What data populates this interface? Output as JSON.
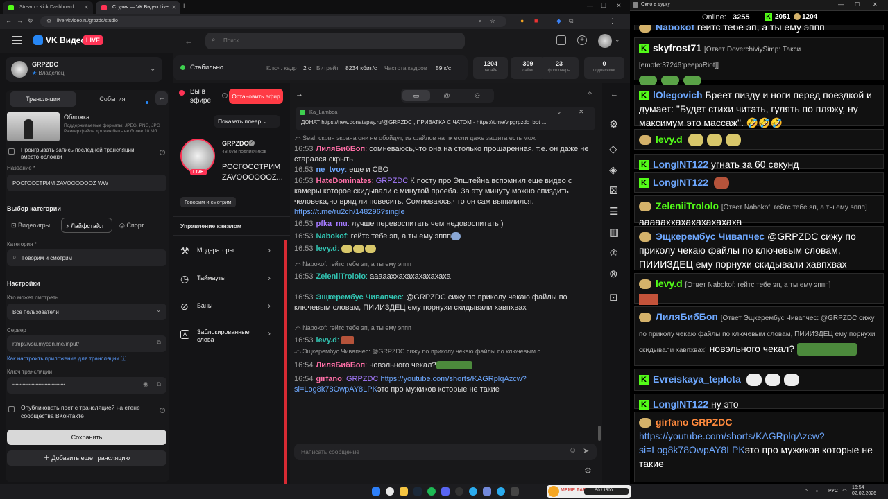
{
  "browser": {
    "tabs": [
      {
        "label": "Stream - Kick Dashboard",
        "color": "#53fc18"
      },
      {
        "label": "Студия — VK Видео Live",
        "color": "#ff3355"
      }
    ],
    "url": "live.vkvideo.ru/grpzdc/studio"
  },
  "vk": {
    "logo": "VK Видео",
    "live_badge": "LIVE",
    "search_placeholder": "Поиск"
  },
  "profile": {
    "name": "GRPZDC",
    "role": "Владелец"
  },
  "status": {
    "state": "Стабильно",
    "keyframe_label": "Ключ. кадр",
    "keyframe": "2 с",
    "bitrate_label": "Битрейт",
    "bitrate": "8234 кбит/с",
    "fps_label": "Частота кадров",
    "fps": "59 к/с"
  },
  "stats": [
    {
      "value": "1204",
      "label": "онлайн"
    },
    {
      "value": "309",
      "label": "лайки"
    },
    {
      "value": "23",
      "label": "фолловеры"
    },
    {
      "value": "0",
      "label": "подписчики"
    }
  ],
  "left": {
    "tab_streams": "Трансляции",
    "tab_events": "События",
    "cover_title": "Обложка",
    "cover_hint": "Поддерживаемые форматы: JPEG, PNG, JPG Размер файла должен быть не более 10 Мб",
    "play_last": "Проигрывать запись последней трансляции вместо обложки",
    "name_label": "Название *",
    "name_value": "РОСГОССТРИМ ZAVOOOOOOZ WW",
    "category_choice": "Выбор категории",
    "cat_games": "Видеоигры",
    "cat_life": "Лайфстайл",
    "cat_sport": "Спорт",
    "category_label": "Категория *",
    "category_value": "Говорим и смотрим",
    "settings": "Настройки",
    "who_label": "Кто может смотреть",
    "who_value": "Все пользователи",
    "server_label": "Сервер",
    "server_value": "rtmp://vsu.mycdn.me/input/",
    "howto": "Как настроить приложение для трансляции",
    "key_label": "Ключ трансляции",
    "key_value": "••••••••••••••••••••••••••••••••••••",
    "publish_post": "Опубликовать пост с трансляцией на стене сообщества ВКонтакте",
    "save": "Сохранить",
    "add_stream": "Добавить еще трансляцию"
  },
  "middle": {
    "on_air": "Вы в эфире",
    "stop": "Остановить эфир",
    "show_player": "Показать плеер",
    "channel": "GRPZDC",
    "subs": "48,078 подписчиков",
    "stream_title": "РОСГОССТРИМ ZAVOOOOOOZ...",
    "category_chip": "Говорим и смотрим",
    "manage": "Управление каналом",
    "menu": [
      "Модераторы",
      "Таймауты",
      "Баны",
      "Заблокированные слова"
    ],
    "live": "LIVE"
  },
  "chat": {
    "pinned_user": "Ka_Lambda",
    "pinned_text": "ДОНАТ https://new.donatepay.ru/@GRPZDC , ПРИВАТКА С ЧАТОМ - https://t.me/vipgrpzdc_bot ...",
    "input_placeholder": "Написать сообщение",
    "messages": [
      {
        "kind": "reply",
        "text": "Seal: скрин экрана они не обойдут, из файлов на пк если даже защита есть мож"
      },
      {
        "kind": "msg",
        "time": "16:53",
        "user": "ЛиляБибБоп",
        "cls": "nm-pink",
        "text": "сомневаюсь,что она на столько прошаренная. т.е. он даже не старался скрыть"
      },
      {
        "kind": "msg",
        "time": "16:53",
        "user": "ne_tvoy",
        "cls": "nm-blue",
        "text": "еще и СВО"
      },
      {
        "kind": "msg",
        "time": "16:53",
        "user": "HateDominates",
        "cls": "nm-pink",
        "mention": "GRPZDC",
        "text": "К посту про Эпштейна вспомнил еще видео с камеры которое скидывали с минутой проеба. За эту минуту можно спиздить человека,но вряд ли повесить. Сомневаюсь,что он сам выпилился.",
        "link": "https://t.me/ru2ch/148296?single"
      },
      {
        "kind": "msg",
        "time": "16:53",
        "user": "pfka_mu",
        "cls": "nm-violet",
        "text": "лучше перевоспитать чем недовоспитать )"
      },
      {
        "kind": "msg",
        "time": "16:53",
        "user": "Nabokof",
        "cls": "nm-teal",
        "text": "гейтс тебе эп, а ты ему эппп"
      },
      {
        "kind": "msg",
        "time": "16:53",
        "user": "levy.d",
        "cls": "nm-teal",
        "text": ""
      },
      {
        "kind": "reply",
        "text": "Nabokof: гейтс тебе эп, а ты ему эппп"
      },
      {
        "kind": "msg",
        "time": "16:53",
        "user": "ZeleniiTrololo",
        "cls": "nm-teal",
        "text": "аааааххахахахахахаха"
      },
      {
        "kind": "msg",
        "time": "16:53",
        "user": "Эщкерембус Чивапчес",
        "cls": "nm-teal",
        "text": "@GRPZDC сижу по приколу чекаю файлы по ключевым словам, ПИИИЗДЕЦ ему порнухи скидывали хавпхвах"
      },
      {
        "kind": "reply",
        "text": "Nabokof: гейтс тебе эп, а ты ему эппп"
      },
      {
        "kind": "msg",
        "time": "16:53",
        "user": "levy.d",
        "cls": "nm-teal",
        "text": ""
      },
      {
        "kind": "reply",
        "text": "Эщкерембус Чивапчес: @GRPZDC сижу по приколу чекаю файлы по ключевым с"
      },
      {
        "kind": "msg",
        "time": "16:54",
        "user": "ЛиляБибБоп",
        "cls": "nm-pink",
        "text": "новэльного чекал?"
      },
      {
        "kind": "msg",
        "time": "16:54",
        "user": "girfano",
        "cls": "nm-pink",
        "mention": "GRPZDC",
        "link": "https://youtube.com/shorts/KAGRplqAzcw?si=Log8k78OwpAY8LPK",
        "text": "это про мужиков которые не такие"
      }
    ]
  },
  "overlay": {
    "title": "Окно в дурку",
    "online_label": "Online:",
    "online": "3255",
    "kick_count": "2051",
    "vk_count": "1204",
    "messages": [
      {
        "user": "Nabokof",
        "text": "гейтс тебе эп, а ты ему эппп",
        "color": "#6ea8ff"
      },
      {
        "user": "skyfrost71",
        "reply": "[Ответ DoverchiviySimp: Такси [emote:37246:peepoRiot]]",
        "text": "",
        "color": "#ffffff"
      },
      {
        "user": "lOlegovich",
        "text": "Бреет пизду и ноги перед поездкой и думает: \"Будет стихи читать, гулять по пляжу, ну максимум это массаж\". 🤣🤣🤣",
        "color": "#6ea8ff"
      },
      {
        "user": "levy.d",
        "text": "",
        "color": "#53fc18"
      },
      {
        "user": "LongINT122",
        "text": "угнать за 60 секунд",
        "color": "#6ea8ff"
      },
      {
        "user": "LongINT122",
        "text": "",
        "color": "#6ea8ff"
      },
      {
        "user": "ZeleniiTrololo",
        "reply": "[Ответ Nabokof: гейтс тебе эп, а ты ему эппп]",
        "text": "аааааххахахахахахаха",
        "color": "#53fc18"
      },
      {
        "user": "Эщкерембус Чивапчес",
        "text": "@GRPZDC сижу по приколу чекаю файлы по ключевым словам, ПИИИЗДЕЦ ему порнухи скидывали хавпхвах",
        "color": "#6ea8ff"
      },
      {
        "user": "levy.d",
        "reply": "[Ответ Nabokof: гейтс тебе эп, а ты ему эппп]",
        "text": "",
        "color": "#53fc18"
      },
      {
        "user": "ЛиляБибБоп",
        "reply": "[Ответ Эщкерембус Чивапчес: @GRPZDC сижу по приколу чекаю файлы по ключевым словам, ПИИИЗДЕЦ ему порнухи скидывали хавпхвах]",
        "text": "новэльного чекал?",
        "color": "#6ea8ff"
      },
      {
        "user": "Evreiskaya_teplota",
        "text": "",
        "color": "#6ea8ff"
      },
      {
        "user": "LongINT122",
        "text": "ну это",
        "color": "#6ea8ff"
      },
      {
        "user": "girfano",
        "mention": "GRPZDC",
        "link": "https://youtube.com/shorts/KAGRplqAzcw?si=Log8k78OwpAY8LPK",
        "text": "это про мужиков которые не такие",
        "color": "#ff8a3d"
      }
    ]
  },
  "taskbar": {
    "lang": "РУС",
    "time": "16:54",
    "date": "02.02.2026",
    "meme": "MEME PARTY",
    "meme_count": "50 / 1500"
  }
}
